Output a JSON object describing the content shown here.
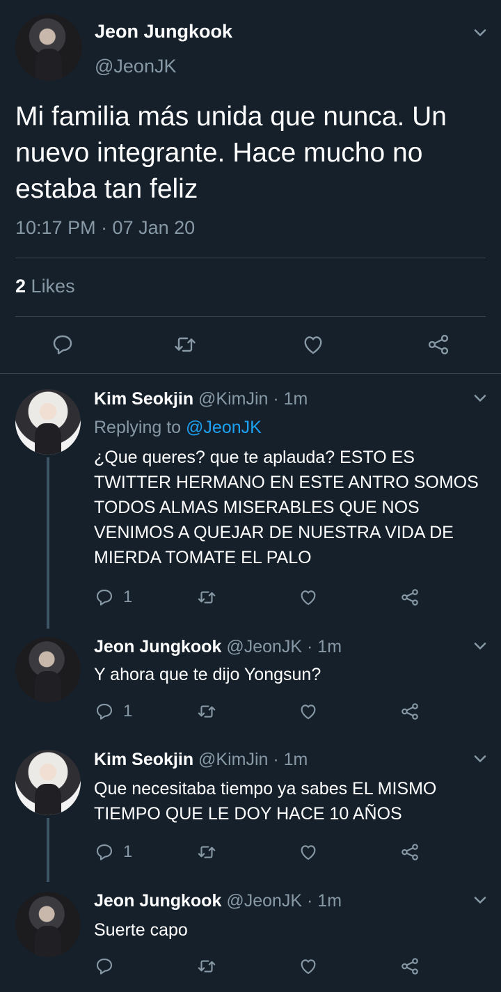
{
  "main_tweet": {
    "author_name": "Jeon Jungkook",
    "author_handle": "@JeonJK",
    "text": "Mi familia más unida que nunca. Un nuevo integrante. Hace mucho no estaba tan feliz",
    "timestamp": "10:17 PM · 07 Jan 20",
    "likes_count": "2",
    "likes_label": "Likes",
    "icons": [
      "reply-icon",
      "retweet-icon",
      "like-icon",
      "share-icon"
    ]
  },
  "replies": [
    {
      "author_name": "Kim Seokjin",
      "meta": " @KimJin · 1m",
      "replying_prefix": "Replying to ",
      "replying_to": "@JeonJK",
      "text": "¿Que queres? que te aplauda?  ESTO ES TWITTER HERMANO EN ESTE ANTRO SOMOS TODOS ALMAS MISERABLES QUE NOS VENIMOS A QUEJAR DE NUESTRA VIDA DE MIERDA TOMATE EL PALO",
      "reply_count": "1"
    },
    {
      "author_name": "Jeon Jungkook",
      "meta": " @JeonJK · 1m",
      "text": "Y ahora que te dijo Yongsun?",
      "reply_count": "1"
    },
    {
      "author_name": "Kim Seokjin",
      "meta": " @KimJin · 1m",
      "text": "Que necesitaba tiempo ya sabes EL MISMO TIEMPO QUE LE DOY HACE 10 AÑOS",
      "reply_count": "1"
    },
    {
      "author_name": "Jeon Jungkook",
      "meta": " @JeonJK · 1m",
      "text": "Suerte capo",
      "reply_count": ""
    }
  ],
  "colors": {
    "background": "#15202b",
    "secondary_text": "#8899a6",
    "link": "#1da1f2",
    "divider": "#38444d"
  }
}
